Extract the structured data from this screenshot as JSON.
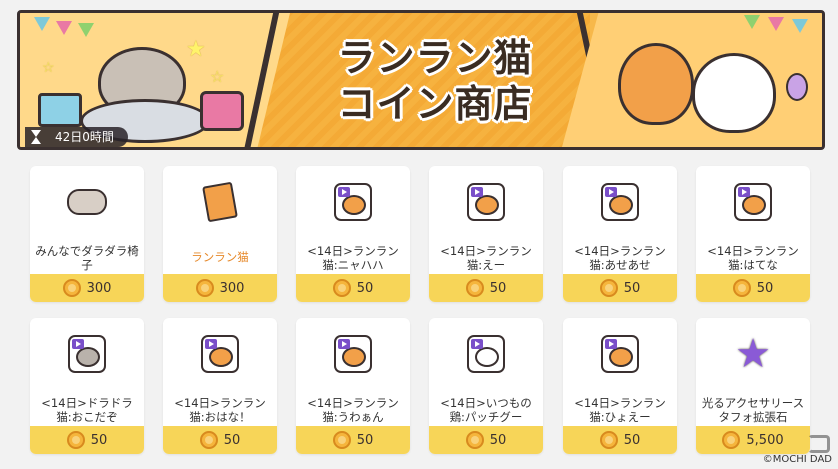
{
  "banner": {
    "title_line1": "ランラン猫",
    "title_line2": "コイン商店",
    "timer_text": "42日0時間"
  },
  "items": [
    {
      "name": "みんなでダラダラ椅子",
      "price": "300",
      "highlight": false,
      "icon": "cats-on-chair-icon"
    },
    {
      "name": "ランラン猫",
      "price": "300",
      "highlight": true,
      "icon": "book-icon"
    },
    {
      "name": "<14日>ランラン猫:ニャハハ",
      "price": "50",
      "highlight": false,
      "icon": "sticker-orange-cat-icon"
    },
    {
      "name": "<14日>ランラン猫:えー",
      "price": "50",
      "highlight": false,
      "icon": "sticker-orange-cat-icon"
    },
    {
      "name": "<14日>ランラン猫:あせあせ",
      "price": "50",
      "highlight": false,
      "icon": "sticker-orange-cat-icon"
    },
    {
      "name": "<14日>ランラン猫:はてな",
      "price": "50",
      "highlight": false,
      "icon": "sticker-orange-cat-question-icon"
    },
    {
      "name": "<14日>ドラドラ猫:おこだぞ",
      "price": "50",
      "highlight": false,
      "icon": "sticker-gray-cat-icon"
    },
    {
      "name": "<14日>ランラン猫:おはな！",
      "price": "50",
      "highlight": false,
      "icon": "sticker-orange-cat-icon"
    },
    {
      "name": "<14日>ランラン猫:うわぁん",
      "price": "50",
      "highlight": false,
      "icon": "sticker-orange-cat-icon"
    },
    {
      "name": "<14日>いつもの鶏:パッチグー",
      "price": "50",
      "highlight": false,
      "icon": "sticker-chicken-icon"
    },
    {
      "name": "<14日>ランラン猫:ひょえー",
      "price": "50",
      "highlight": false,
      "icon": "sticker-orange-cat-icon"
    },
    {
      "name": "光るアクセサリースタフォ拡張石",
      "price": "5,500",
      "highlight": false,
      "icon": "purple-star-icon"
    }
  ],
  "watermark": "©MOCHI DAD",
  "colors": {
    "price_bar": "#f7d558",
    "banner_bg": "#f7b84a",
    "highlight_text": "#e6892b",
    "sticker_tag": "#7a4fc9"
  }
}
